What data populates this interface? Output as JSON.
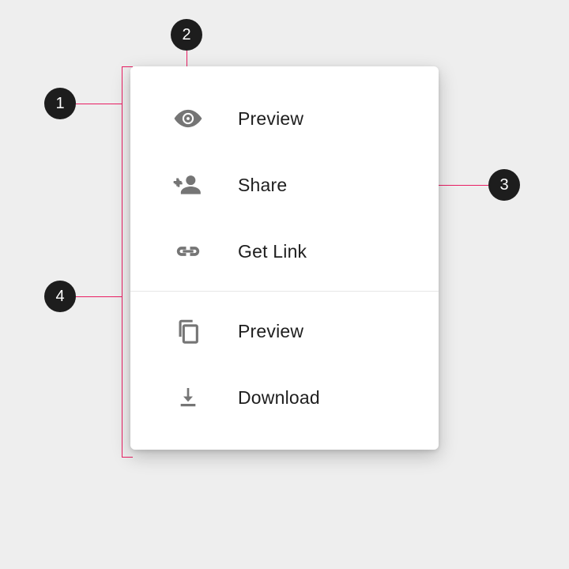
{
  "callouts": {
    "c1": "1",
    "c2": "2",
    "c3": "3",
    "c4": "4"
  },
  "menu": {
    "group1": {
      "item1": {
        "label": "Preview",
        "icon": "eye-icon"
      },
      "item2": {
        "label": "Share",
        "icon": "person-add-icon"
      },
      "item3": {
        "label": "Get Link",
        "icon": "link-icon"
      }
    },
    "group2": {
      "item4": {
        "label": "Preview",
        "icon": "copy-icon"
      },
      "item5": {
        "label": "Download",
        "icon": "download-icon"
      }
    }
  },
  "colors": {
    "connector": "#e91e63",
    "iconFill": "#757575",
    "text": "#1e1e1e",
    "calloutBg": "#1d1d1d"
  }
}
